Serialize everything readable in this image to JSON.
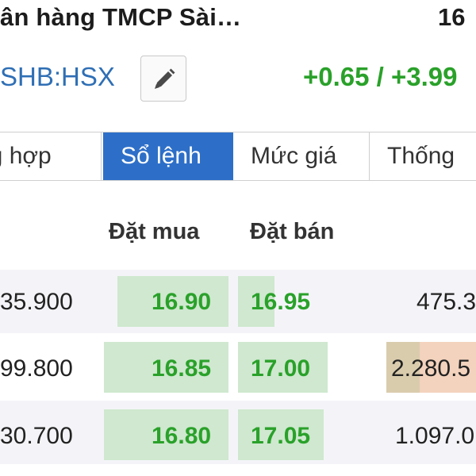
{
  "header": {
    "title": "ân hàng TMCP Sài…",
    "price_partial": "16",
    "ticker": "SHB:HSX",
    "change": "+0.65 / +3.99"
  },
  "tabs": [
    {
      "label": "ng hợp",
      "active": false
    },
    {
      "label": "Sổ lệnh",
      "active": true
    },
    {
      "label": "Mức giá",
      "active": false
    },
    {
      "label": "Thống",
      "active": false
    }
  ],
  "orderbook": {
    "columns": {
      "buy": "Đặt mua",
      "sell": "Đặt bán"
    },
    "rows": [
      {
        "bid_volume": "35.900",
        "bid_price": "16.90",
        "ask_price": "16.95",
        "ask_volume": "475.3"
      },
      {
        "bid_volume": "99.800",
        "bid_price": "16.85",
        "ask_price": "17.00",
        "ask_volume": "2.280.5"
      },
      {
        "bid_volume": "30.700",
        "bid_price": "16.80",
        "ask_price": "17.05",
        "ask_volume": "1.097.0"
      }
    ]
  },
  "icons": {
    "edit": "pencil-icon"
  },
  "colors": {
    "accent_blue": "#2d6fc8",
    "up_green": "#2aa12a",
    "ticker_blue": "#2f6fb5"
  }
}
